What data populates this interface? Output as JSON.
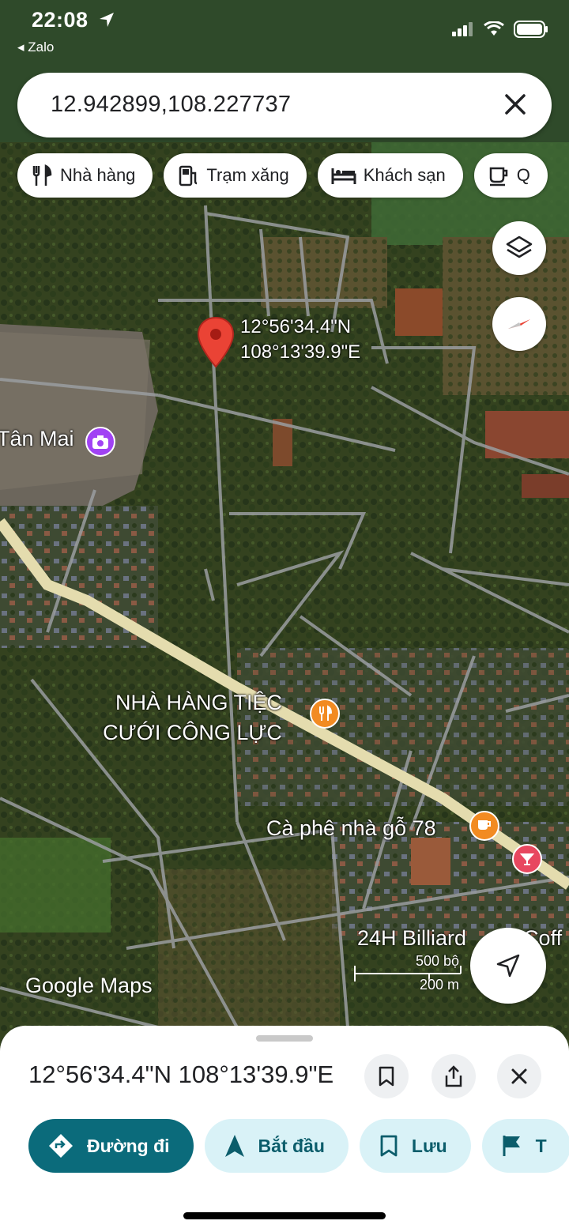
{
  "status_bar": {
    "time": "22:08",
    "back_app": "Zalo"
  },
  "search": {
    "value": "12.942899,108.227737"
  },
  "chips": [
    {
      "label": "Nhà hàng",
      "icon": "restaurant-icon"
    },
    {
      "label": "Trạm xăng",
      "icon": "gas-station-icon"
    },
    {
      "label": "Khách sạn",
      "icon": "hotel-icon"
    },
    {
      "label": "Q",
      "icon": "coffee-icon"
    }
  ],
  "map": {
    "pin": {
      "lat": "12°56'34.4\"N",
      "lng": "108°13'39.9\"E"
    },
    "labels": {
      "tan_mai": "Tân Mai",
      "restaurant_line1": "NHÀ HÀNG TIỆC",
      "restaurant_line2": "CƯỚI CÔNG LỰC",
      "cafe": "Cà phê nhà gỗ 78",
      "billiard": "24H Billiard",
      "billiard_tail": "Coff"
    },
    "watermark": "Google Maps",
    "scale": {
      "imperial": "500 bộ",
      "metric": "200 m"
    }
  },
  "sheet": {
    "title": "12°56'34.4\"N 108°13'39.9\"E",
    "actions": [
      {
        "label": "Đường đi",
        "icon": "directions-icon"
      },
      {
        "label": "Bắt đầu",
        "icon": "navigation-arrow-icon"
      },
      {
        "label": "Lưu",
        "icon": "bookmark-icon"
      },
      {
        "label": "T",
        "icon": "flag-icon"
      }
    ]
  },
  "colors": {
    "accent": "#0b6b7b",
    "pin": "#ea4335",
    "action_bg": "#d9f2f7"
  }
}
